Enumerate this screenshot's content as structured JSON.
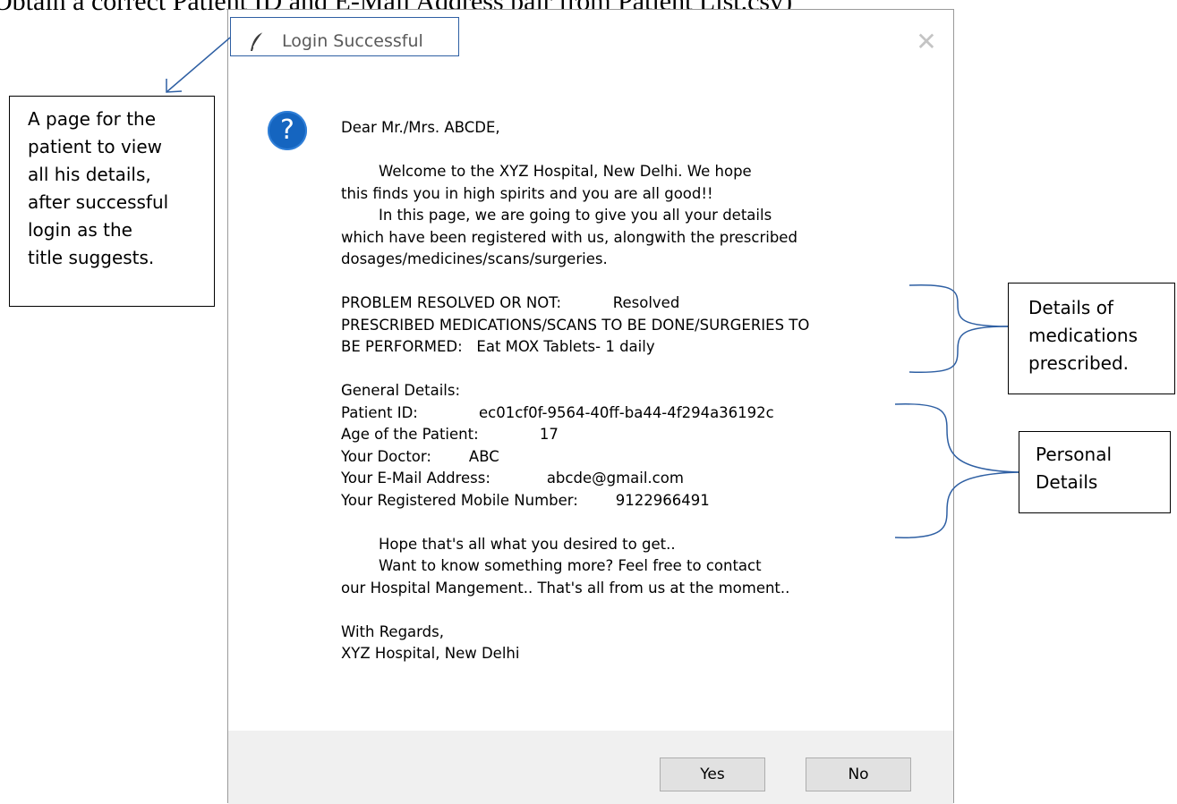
{
  "document": {
    "heading": "Obtain a correct Patient ID and E-Mail Address pair from Patient List.csv)"
  },
  "dialog": {
    "title": "Login Successful",
    "close_glyph": "✕",
    "question_icon_glyph": "?",
    "message_lines": [
      "Dear Mr./Mrs. ABCDE,",
      "",
      "\t\tWelcome to the XYZ Hospital, New Delhi. We hope",
      "this finds you in high spirits and you are all good!!",
      "\t\tIn this page, we are going to give you all your details",
      "which have been registered with us, alongwith the prescribed",
      "dosages/medicines/scans/surgeries.",
      "",
      "PROBLEM RESOLVED OR NOT:           Resolved",
      "PRESCRIBED MEDICATIONS/SCANS TO BE DONE/SURGERIES TO",
      "BE PERFORMED:   Eat MOX Tablets- 1 daily",
      "",
      "General Details:",
      "Patient ID:             ec01cf0f-9564-40ff-ba44-4f294a36192c",
      "Age of the Patient:             17",
      "Your Doctor:        ABC",
      "Your E-Mail Address:            abcde@gmail.com",
      "Your Registered Mobile Number:        9122966491",
      "",
      "\t\tHope that's all what you desired to get..",
      "\t\tWant to know something more? Feel free to contact",
      "our Hospital Mangement.. That's all from us at the moment..",
      "",
      "With Regards,",
      "XYZ Hospital, New Delhi"
    ],
    "buttons": {
      "yes": "Yes",
      "no": "No"
    }
  },
  "annotations": {
    "left_callout": [
      "A page for the",
      "patient to view",
      "all his details,",
      "after successful",
      "login as the",
      "title suggests."
    ],
    "medications_callout": [
      "Details of",
      "medications",
      "prescribed."
    ],
    "personal_callout": [
      "Personal",
      "Details"
    ]
  },
  "colors": {
    "annotation_line": "#2e5fa3",
    "question_icon": "#1565c0",
    "footer_bg": "#f0f0f0",
    "button_bg": "#e1e1e1"
  },
  "icons": {
    "title": "feather-icon",
    "message": "question-icon",
    "close": "close-icon"
  }
}
